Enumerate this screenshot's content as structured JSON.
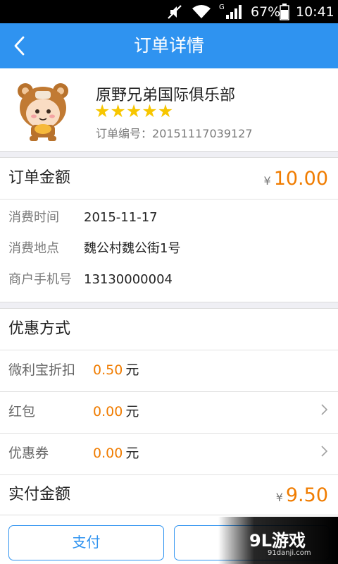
{
  "status_bar": {
    "battery_percent": "67%",
    "time": "10:41",
    "network_type": "G",
    "icons": [
      "mute-icon",
      "wifi-icon",
      "signal-icon",
      "battery-icon"
    ]
  },
  "nav": {
    "title": "订单详情",
    "back_icon": "chevron-left-icon"
  },
  "merchant": {
    "name": "原野兄弟国际俱乐部",
    "rating_stars": 5,
    "order_number_label": "订单编号：",
    "order_number": "20151117039127",
    "avatar_icon": "bear-mascot-avatar"
  },
  "order": {
    "amount_label": "订单金额",
    "currency_symbol": "¥",
    "amount": "10.00",
    "details": [
      {
        "label": "消费时间",
        "value": "2015-11-17"
      },
      {
        "label": "消费地点",
        "value": "魏公村魏公街1号"
      },
      {
        "label": "商户手机号",
        "value": "13130000004"
      }
    ]
  },
  "discounts": {
    "title": "优惠方式",
    "items": [
      {
        "label": "微利宝折扣",
        "value": "0.50",
        "unit": "元",
        "has_arrow": false
      },
      {
        "label": "红包",
        "value": "0.00",
        "unit": "元",
        "has_arrow": true
      },
      {
        "label": "优惠券",
        "value": "0.00",
        "unit": "元",
        "has_arrow": true
      }
    ],
    "paid_label": "实付金额",
    "currency_symbol": "¥",
    "paid_amount": "9.50"
  },
  "actions": {
    "pay_label": "支付"
  },
  "watermark": {
    "brand": "9L游戏",
    "url": "91danji.com"
  },
  "colors": {
    "accent": "#2f93f0",
    "amount": "#f07c00",
    "star": "#f7c600"
  }
}
